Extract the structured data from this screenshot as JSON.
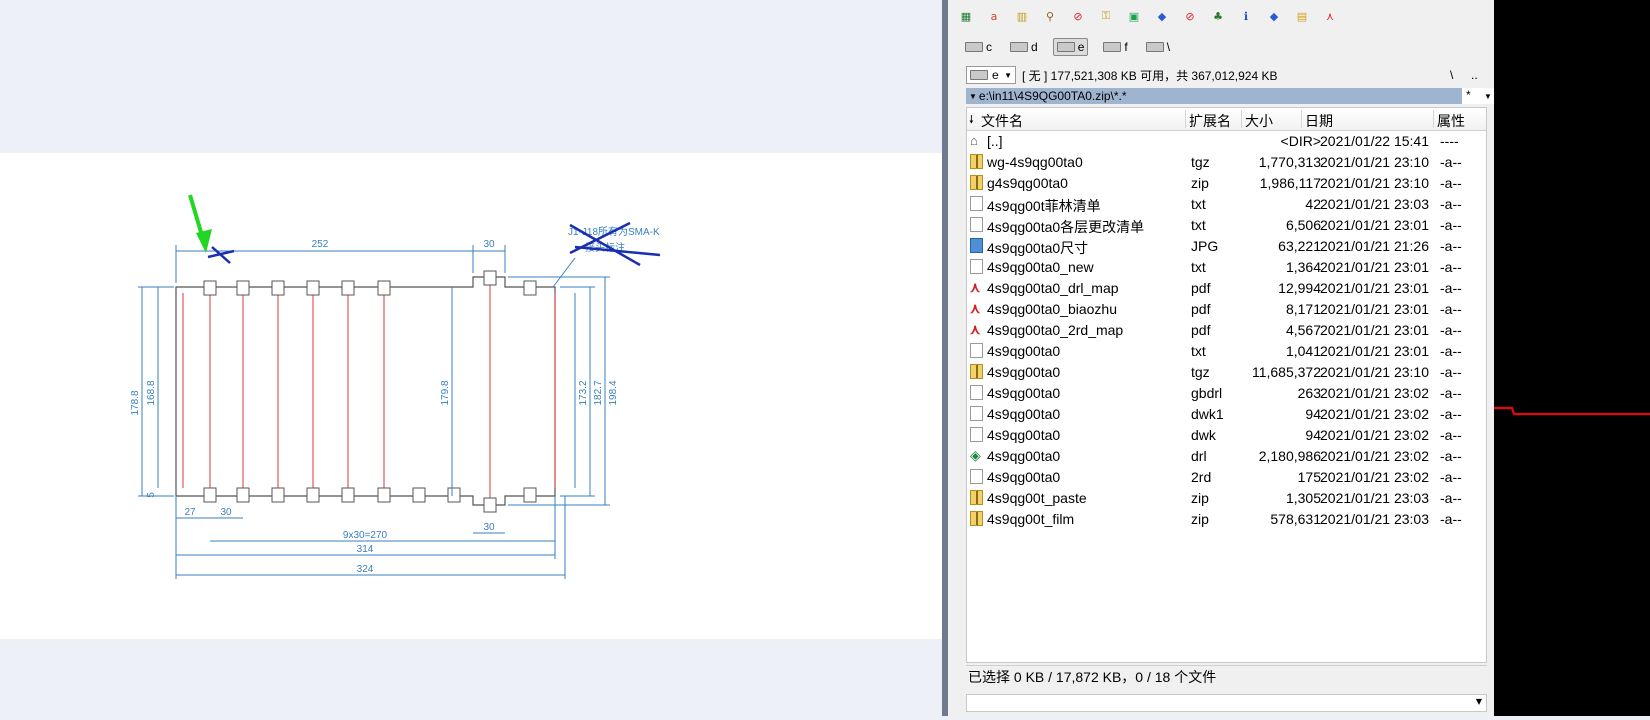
{
  "toolbar": {
    "icons": [
      "excel-icon",
      "text-editor-icon",
      "archive-icon",
      "search-files-icon",
      "stop-icon",
      "key-icon",
      "ftp-icon",
      "package-icon",
      "stop-icon",
      "network-icon",
      "info-icon",
      "package-icon",
      "folder-key-icon",
      "pdf-icon"
    ]
  },
  "drives": [
    {
      "letter": "c",
      "active": false
    },
    {
      "letter": "d",
      "active": false
    },
    {
      "letter": "e",
      "active": true
    },
    {
      "letter": "f",
      "active": false
    },
    {
      "letter": "\\",
      "active": false
    }
  ],
  "pathbar": {
    "drive_select": "e",
    "free_space": "[ 无 ]  177,521,308 KB 可用，共 367,012,924 KB",
    "root_button": "\\",
    "up_button": ".."
  },
  "current_path": {
    "text": "e:\\in11\\4S9QG00TA0.zip\\*.*",
    "filter": "*"
  },
  "columns": {
    "name": "文件名",
    "ext": "扩展名",
    "size": "大小",
    "date": "日期",
    "attr": "属性"
  },
  "files": [
    {
      "icon": "up",
      "name": "[..]",
      "ext": "",
      "size": "<DIR>",
      "date": "2021/01/22 15:41",
      "attr": "----"
    },
    {
      "icon": "zip",
      "name": "wg-4s9qg00ta0",
      "ext": "tgz",
      "size": "1,770,313",
      "date": "2021/01/21 23:10",
      "attr": "-a--"
    },
    {
      "icon": "zip",
      "name": "g4s9qg00ta0",
      "ext": "zip",
      "size": "1,986,117",
      "date": "2021/01/21 23:10",
      "attr": "-a--"
    },
    {
      "icon": "txt",
      "name": "4s9qg00t菲林清单",
      "ext": "txt",
      "size": "42",
      "date": "2021/01/21 23:03",
      "attr": "-a--"
    },
    {
      "icon": "txt",
      "name": "4s9qg00ta0各层更改清单",
      "ext": "txt",
      "size": "6,506",
      "date": "2021/01/21 23:01",
      "attr": "-a--"
    },
    {
      "icon": "jpg",
      "name": "4s9qg00ta0尺寸",
      "ext": "JPG",
      "size": "63,221",
      "date": "2021/01/21 21:26",
      "attr": "-a--"
    },
    {
      "icon": "txt",
      "name": "4s9qg00ta0_new",
      "ext": "txt",
      "size": "1,364",
      "date": "2021/01/21 23:01",
      "attr": "-a--"
    },
    {
      "icon": "pdf",
      "name": "4s9qg00ta0_drl_map",
      "ext": "pdf",
      "size": "12,994",
      "date": "2021/01/21 23:01",
      "attr": "-a--"
    },
    {
      "icon": "pdf",
      "name": "4s9qg00ta0_biaozhu",
      "ext": "pdf",
      "size": "8,171",
      "date": "2021/01/21 23:01",
      "attr": "-a--"
    },
    {
      "icon": "pdf",
      "name": "4s9qg00ta0_2rd_map",
      "ext": "pdf",
      "size": "4,567",
      "date": "2021/01/21 23:01",
      "attr": "-a--"
    },
    {
      "icon": "txt",
      "name": "4s9qg00ta0",
      "ext": "txt",
      "size": "1,041",
      "date": "2021/01/21 23:01",
      "attr": "-a--"
    },
    {
      "icon": "zip",
      "name": "4s9qg00ta0",
      "ext": "tgz",
      "size": "11,685,372",
      "date": "2021/01/21 23:10",
      "attr": "-a--"
    },
    {
      "icon": "txt",
      "name": "4s9qg00ta0",
      "ext": "gbdrl",
      "size": "263",
      "date": "2021/01/21 23:02",
      "attr": "-a--"
    },
    {
      "icon": "txt",
      "name": "4s9qg00ta0",
      "ext": "dwk1",
      "size": "94",
      "date": "2021/01/21 23:02",
      "attr": "-a--"
    },
    {
      "icon": "txt",
      "name": "4s9qg00ta0",
      "ext": "dwk",
      "size": "94",
      "date": "2021/01/21 23:02",
      "attr": "-a--"
    },
    {
      "icon": "drl",
      "name": "4s9qg00ta0",
      "ext": "drl",
      "size": "2,180,986",
      "date": "2021/01/21 23:02",
      "attr": "-a--"
    },
    {
      "icon": "txt",
      "name": "4s9qg00ta0",
      "ext": "2rd",
      "size": "175",
      "date": "2021/01/21 23:02",
      "attr": "-a--"
    },
    {
      "icon": "zip",
      "name": "4s9qg00t_paste",
      "ext": "zip",
      "size": "1,305",
      "date": "2021/01/21 23:03",
      "attr": "-a--"
    },
    {
      "icon": "zip",
      "name": "4s9qg00t_film",
      "ext": "zip",
      "size": "578,631",
      "date": "2021/01/21 23:03",
      "attr": "-a--"
    }
  ],
  "status": "已选择 0 KB / 17,872 KB，0 / 18 个文件",
  "drawing": {
    "dims": {
      "top_width": "252",
      "top_right": "30",
      "left_outer": "178.8",
      "left_inner": "168.8",
      "center": "179.8",
      "right_a": "173.2",
      "right_b": "182.7",
      "right_c": "198.4",
      "bottom_27": "27",
      "bottom_30": "30",
      "bottom_pitch": "9x30=270",
      "bottom_314": "314",
      "bottom_324": "324",
      "bottom_right_30": "30",
      "left_small": "5"
    },
    "note_line1": "J1-J18所有为SMA-K",
    "note_line2": "接头标注"
  }
}
